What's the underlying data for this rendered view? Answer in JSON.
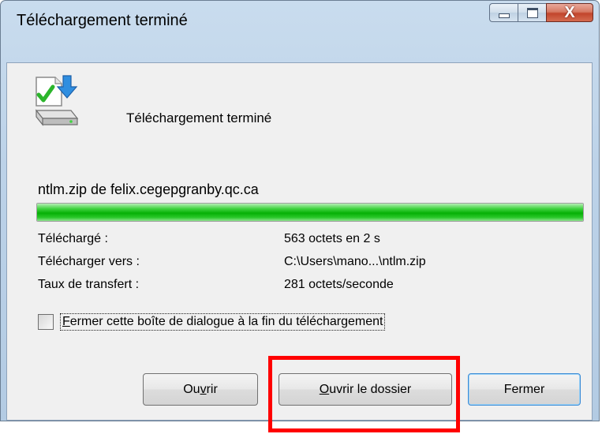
{
  "window": {
    "title": "Téléchargement terminé",
    "close_glyph": "X"
  },
  "header": {
    "status_text": "Téléchargement terminé",
    "icon": "download-complete-icon"
  },
  "download": {
    "source": "ntlm.zip de felix.cegepgranby.qc.ca",
    "progress_fraction": 1.0,
    "progress_color": "#06b006"
  },
  "details": {
    "downloaded_label": "Téléchargé :",
    "downloaded_value": "563 octets en 2 s",
    "target_label": "Télécharger vers :",
    "target_value": "C:\\Users\\mano...\\ntlm.zip",
    "rate_label": "Taux de transfert :",
    "rate_value": "281 octets/seconde"
  },
  "options": {
    "close_on_finish_first": "F",
    "close_on_finish_rest": "ermer cette boîte de dialogue à la fin du téléchargement",
    "close_on_finish_checked": false
  },
  "buttons": {
    "open_before": "Ou",
    "open_accel": "v",
    "open_after": "rir",
    "open_folder_accel": "O",
    "open_folder_rest": "uvrir le dossier",
    "close_label": "Fermer"
  },
  "annotation": {
    "highlight_color": "#ff0000"
  }
}
